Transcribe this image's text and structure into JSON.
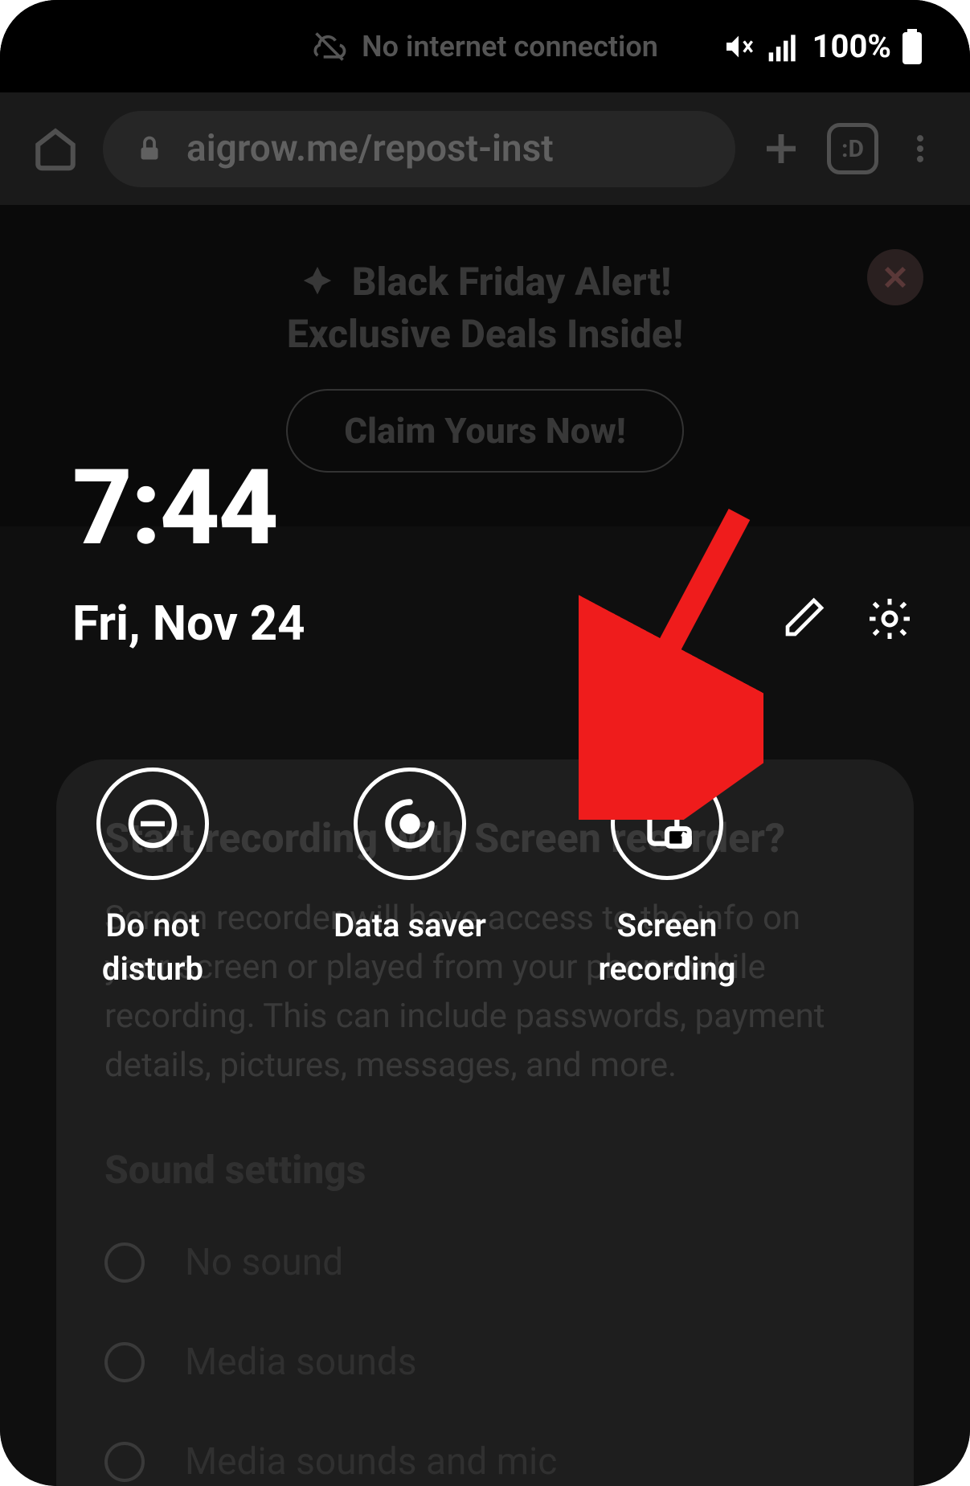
{
  "status_bar": {
    "message": "No internet connection",
    "battery_text": "100%"
  },
  "browser": {
    "url_display": "aigrow.me/repost-inst",
    "tab_indicator": ":D"
  },
  "banner": {
    "line1": "Black Friday Alert!",
    "line2": "Exclusive Deals Inside!",
    "cta": "Claim Yours Now!"
  },
  "dialog": {
    "title": "Start recording with Screen recorder?",
    "body": "Screen recorder will have access to the info on your screen or played from your phone while recording. This can include passwords, payment details, pictures, messages, and more.",
    "sound_heading": "Sound settings",
    "options": {
      "0": "No sound",
      "1": "Media sounds",
      "2": "Media sounds and mic"
    }
  },
  "quick_settings": {
    "time": "7:44",
    "date": "Fri, Nov 24",
    "tiles": {
      "dnd": "Do not disturb",
      "data_saver": "Data saver",
      "screen_recording": "Screen recording"
    }
  }
}
